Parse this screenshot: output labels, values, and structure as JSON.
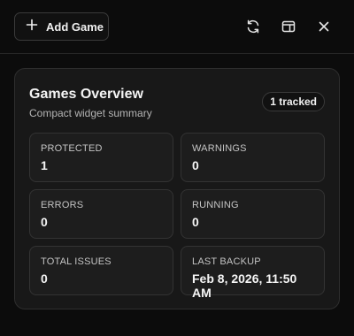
{
  "toolbar": {
    "add_label": "Add Game",
    "icons": [
      "plus-icon",
      "refresh-icon",
      "layout-panel-icon",
      "close-icon"
    ]
  },
  "overview": {
    "title": "Games Overview",
    "subtitle": "Compact widget summary",
    "badge": "1 tracked",
    "stats": [
      {
        "label": "PROTECTED",
        "value": "1"
      },
      {
        "label": "WARNINGS",
        "value": "0"
      },
      {
        "label": "ERRORS",
        "value": "0"
      },
      {
        "label": "RUNNING",
        "value": "0"
      },
      {
        "label": "TOTAL ISSUES",
        "value": "0"
      },
      {
        "label": "LAST BACKUP",
        "value": "Feb 8, 2026, 11:50 AM"
      }
    ]
  },
  "colors": {
    "background": "#0c0c0c",
    "card": "#181818",
    "border": "#2e2e2e",
    "text": "#f5f5f5",
    "muted": "#b4b4b4"
  }
}
